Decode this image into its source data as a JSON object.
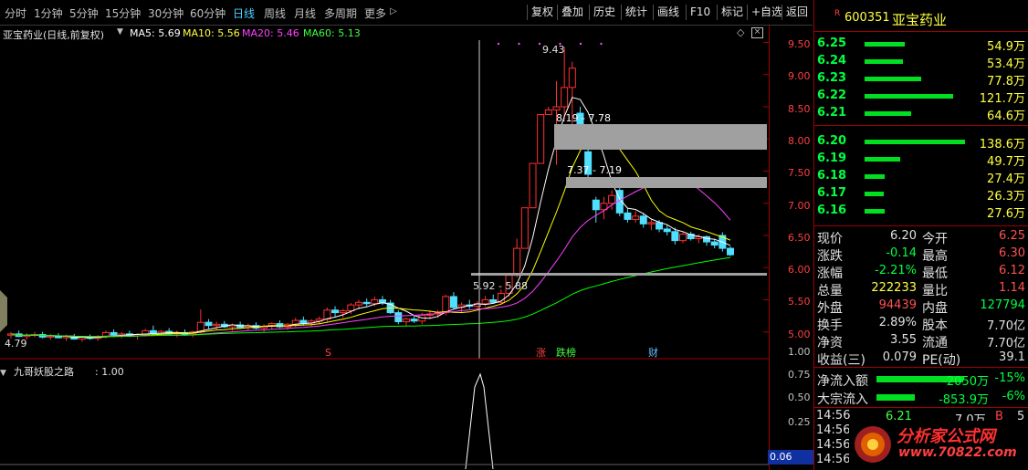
{
  "nav": {
    "periods": [
      "分时",
      "1分钟",
      "5分钟",
      "15分钟",
      "30分钟",
      "60分钟",
      "日线",
      "周线",
      "月线",
      "多周期",
      "更多"
    ],
    "more_arrow": "▷",
    "tools": [
      "复权",
      "叠加",
      "历史",
      "统计",
      "画线",
      "F10",
      "标记",
      "+自选",
      "返回"
    ]
  },
  "title": {
    "stock": "亚宝药业(日线,前复权)",
    "ma5": "MA5: 5.69",
    "ma10": "MA10: 5.56",
    "ma20": "MA20: 5.46",
    "ma60": "MA60: 5.13"
  },
  "colors": {
    "ma5": "#ffffff",
    "ma10": "#ffff00",
    "ma20": "#ff40ff",
    "ma60": "#00ff00",
    "up": "#ff3030",
    "down": "#50e0ff"
  },
  "annot": {
    "high": "9.43",
    "range1": "8.19 - 7.78",
    "range2": "7.37 - 7.19",
    "range3": "5.92 - 5.88",
    "low": "4.79",
    "marks": [
      {
        "text": "S"
      },
      {
        "text": "涨"
      },
      {
        "text": "跌榜"
      },
      {
        "text": "财"
      }
    ]
  },
  "yaxis": {
    "ticks": [
      "9.50",
      "9.00",
      "8.50",
      "8.00",
      "7.50",
      "7.00",
      "6.50",
      "6.00",
      "5.50",
      "5.00"
    ],
    "ind_ticks": [
      "1.00",
      "0.75",
      "0.50",
      "0.25"
    ],
    "ind_cur": "0.06"
  },
  "indicator": {
    "name": "九哥妖股之路",
    "value": ": 1.00"
  },
  "chart_data": {
    "type": "candlestick",
    "title": "亚宝药业(日线,前复权)",
    "ylim": [
      4.5,
      9.5
    ],
    "max": 9.43,
    "min": 4.79,
    "candles": [
      [
        4.95,
        5.0,
        4.9,
        4.97
      ],
      [
        4.97,
        5.02,
        4.92,
        4.93
      ],
      [
        4.93,
        4.98,
        4.88,
        4.95
      ],
      [
        4.95,
        5.0,
        4.92,
        4.96
      ],
      [
        4.96,
        5.0,
        4.9,
        4.92
      ],
      [
        4.92,
        4.97,
        4.88,
        4.94
      ],
      [
        4.94,
        4.98,
        4.9,
        4.91
      ],
      [
        4.91,
        4.96,
        4.86,
        4.93
      ],
      [
        4.93,
        4.97,
        4.88,
        4.89
      ],
      [
        4.89,
        4.94,
        4.85,
        4.92
      ],
      [
        4.92,
        4.96,
        4.88,
        4.9
      ],
      [
        4.9,
        4.95,
        4.86,
        4.93
      ],
      [
        4.93,
        5.02,
        4.9,
        4.99
      ],
      [
        4.99,
        5.04,
        4.92,
        4.95
      ],
      [
        4.95,
        5.0,
        4.9,
        4.97
      ],
      [
        4.97,
        5.02,
        4.92,
        4.94
      ],
      [
        4.94,
        4.98,
        4.88,
        4.96
      ],
      [
        4.96,
        5.05,
        4.93,
        5.02
      ],
      [
        5.02,
        5.1,
        4.96,
        4.98
      ],
      [
        4.98,
        5.03,
        4.94,
        5.01
      ],
      [
        5.01,
        5.06,
        4.96,
        4.97
      ],
      [
        4.97,
        5.02,
        4.92,
        4.99
      ],
      [
        4.99,
        5.04,
        4.94,
        4.96
      ],
      [
        4.96,
        5.02,
        4.92,
        5.0
      ],
      [
        5.0,
        5.35,
        4.98,
        5.15
      ],
      [
        5.15,
        5.2,
        5.05,
        5.1
      ],
      [
        5.1,
        5.16,
        5.04,
        5.12
      ],
      [
        5.12,
        5.17,
        5.06,
        5.08
      ],
      [
        5.08,
        5.13,
        5.02,
        5.11
      ],
      [
        5.11,
        5.16,
        5.05,
        5.07
      ],
      [
        5.07,
        5.13,
        5.02,
        5.1
      ],
      [
        5.1,
        5.15,
        5.04,
        5.06
      ],
      [
        5.06,
        5.12,
        5.0,
        5.09
      ],
      [
        5.09,
        5.15,
        5.04,
        5.13
      ],
      [
        5.13,
        5.18,
        5.06,
        5.08
      ],
      [
        5.08,
        5.14,
        5.03,
        5.12
      ],
      [
        5.12,
        5.22,
        5.08,
        5.18
      ],
      [
        5.18,
        5.24,
        5.1,
        5.14
      ],
      [
        5.14,
        5.2,
        5.08,
        5.17
      ],
      [
        5.17,
        5.24,
        5.12,
        5.2
      ],
      [
        5.2,
        5.38,
        5.16,
        5.34
      ],
      [
        5.34,
        5.4,
        5.24,
        5.3
      ],
      [
        5.3,
        5.36,
        5.22,
        5.33
      ],
      [
        5.33,
        5.45,
        5.28,
        5.42
      ],
      [
        5.42,
        5.5,
        5.35,
        5.46
      ],
      [
        5.46,
        5.52,
        5.4,
        5.44
      ],
      [
        5.44,
        5.55,
        5.4,
        5.5
      ],
      [
        5.5,
        5.56,
        5.42,
        5.45
      ],
      [
        5.45,
        5.5,
        5.28,
        5.3
      ],
      [
        5.3,
        5.34,
        5.12,
        5.16
      ],
      [
        5.16,
        5.22,
        5.1,
        5.2
      ],
      [
        5.2,
        5.26,
        5.14,
        5.17
      ],
      [
        5.17,
        5.3,
        5.12,
        5.26
      ],
      [
        5.26,
        5.34,
        5.2,
        5.28
      ],
      [
        5.28,
        5.34,
        5.22,
        5.3
      ],
      [
        5.3,
        5.58,
        5.26,
        5.55
      ],
      [
        5.55,
        5.62,
        5.35,
        5.38
      ],
      [
        5.38,
        5.46,
        5.3,
        5.42
      ],
      [
        5.42,
        5.5,
        5.36,
        5.4
      ],
      [
        5.4,
        5.48,
        5.34,
        5.44
      ],
      [
        5.44,
        5.56,
        5.4,
        5.5
      ],
      [
        5.5,
        5.58,
        5.44,
        5.46
      ],
      [
        5.46,
        5.66,
        5.42,
        5.6
      ],
      [
        5.6,
        5.92,
        5.55,
        5.88
      ],
      [
        5.88,
        6.45,
        5.85,
        6.3
      ],
      [
        6.3,
        6.93,
        6.3,
        6.93
      ],
      [
        6.93,
        7.62,
        6.93,
        7.62
      ],
      [
        7.62,
        8.38,
        7.62,
        8.38
      ],
      [
        8.38,
        8.5,
        8.38,
        8.45
      ],
      [
        8.45,
        8.9,
        7.6,
        8.5
      ],
      [
        8.5,
        9.43,
        8.3,
        8.8
      ],
      [
        8.8,
        9.2,
        8.22,
        9.1
      ],
      [
        8.4,
        8.5,
        8.19,
        8.22
      ],
      [
        7.8,
        7.9,
        7.38,
        7.45
      ],
      [
        7.05,
        7.1,
        6.7,
        6.9
      ],
      [
        6.9,
        7.1,
        6.75,
        7.0
      ],
      [
        7.0,
        7.2,
        6.9,
        7.12
      ],
      [
        7.2,
        7.25,
        6.8,
        6.85
      ],
      [
        6.85,
        6.92,
        6.7,
        6.75
      ],
      [
        6.75,
        6.88,
        6.7,
        6.8
      ],
      [
        6.8,
        6.85,
        6.62,
        6.68
      ],
      [
        6.68,
        6.75,
        6.58,
        6.7
      ],
      [
        6.7,
        6.74,
        6.55,
        6.6
      ],
      [
        6.6,
        6.66,
        6.5,
        6.56
      ],
      [
        6.56,
        6.62,
        6.36,
        6.42
      ],
      [
        6.42,
        6.55,
        6.38,
        6.52
      ],
      [
        6.52,
        6.56,
        6.42,
        6.45
      ],
      [
        6.45,
        6.52,
        6.38,
        6.48
      ],
      [
        6.48,
        6.5,
        6.34,
        6.4
      ],
      [
        6.4,
        6.45,
        6.3,
        6.35
      ],
      [
        6.5,
        6.55,
        6.25,
        6.3
      ],
      [
        6.3,
        6.33,
        6.18,
        6.2
      ]
    ]
  },
  "quote": {
    "code": "600351",
    "name": "亚宝药业",
    "sell_label": "R",
    "asks": [
      {
        "p": "6.25",
        "v": "54.9万"
      },
      {
        "p": "6.24",
        "v": "53.4万"
      },
      {
        "p": "6.23",
        "v": "77.8万"
      },
      {
        "p": "6.22",
        "v": "121.7万"
      },
      {
        "p": "6.21",
        "v": "64.6万"
      }
    ],
    "bids": [
      {
        "p": "6.20",
        "v": "138.6万"
      },
      {
        "p": "6.19",
        "v": "49.7万"
      },
      {
        "p": "6.18",
        "v": "27.4万"
      },
      {
        "p": "6.17",
        "v": "26.3万"
      },
      {
        "p": "6.16",
        "v": "27.6万"
      }
    ],
    "stats": [
      {
        "l1": "现价",
        "v1": "6.20",
        "l2": "今开",
        "v2": "6.25"
      },
      {
        "l1": "涨跌",
        "v1": "-0.14",
        "l2": "最高",
        "v2": "6.30"
      },
      {
        "l1": "涨幅",
        "v1": "-2.21%",
        "l2": "最低",
        "v2": "6.12"
      },
      {
        "l1": "总量",
        "v1": "222233",
        "l2": "量比",
        "v2": "1.14"
      },
      {
        "l1": "外盘",
        "v1": "94439",
        "l2": "内盘",
        "v2": "127794"
      },
      {
        "l1": "换手",
        "v1": "2.89%",
        "l2": "股本",
        "v2": "7.70亿"
      },
      {
        "l1": "净资",
        "v1": "3.55",
        "l2": "流通",
        "v2": "7.70亿"
      },
      {
        "l1": "收益(三)",
        "v1": "0.079",
        "l2": "PE(动)",
        "v2": "39.1"
      }
    ],
    "flows": [
      {
        "label": "净流入额",
        "value": "-2050万",
        "pct": "-15%"
      },
      {
        "label": "大宗流入",
        "value": "-853.9万",
        "pct": "-6%"
      }
    ],
    "ticks": [
      "14:56",
      "14:56",
      "14:56",
      "14:56"
    ],
    "tick_vals": [
      "6.21",
      "7.0万",
      "B",
      "5"
    ],
    "watermark_title": "分析家公式网",
    "watermark_url": "www.70822.com"
  }
}
